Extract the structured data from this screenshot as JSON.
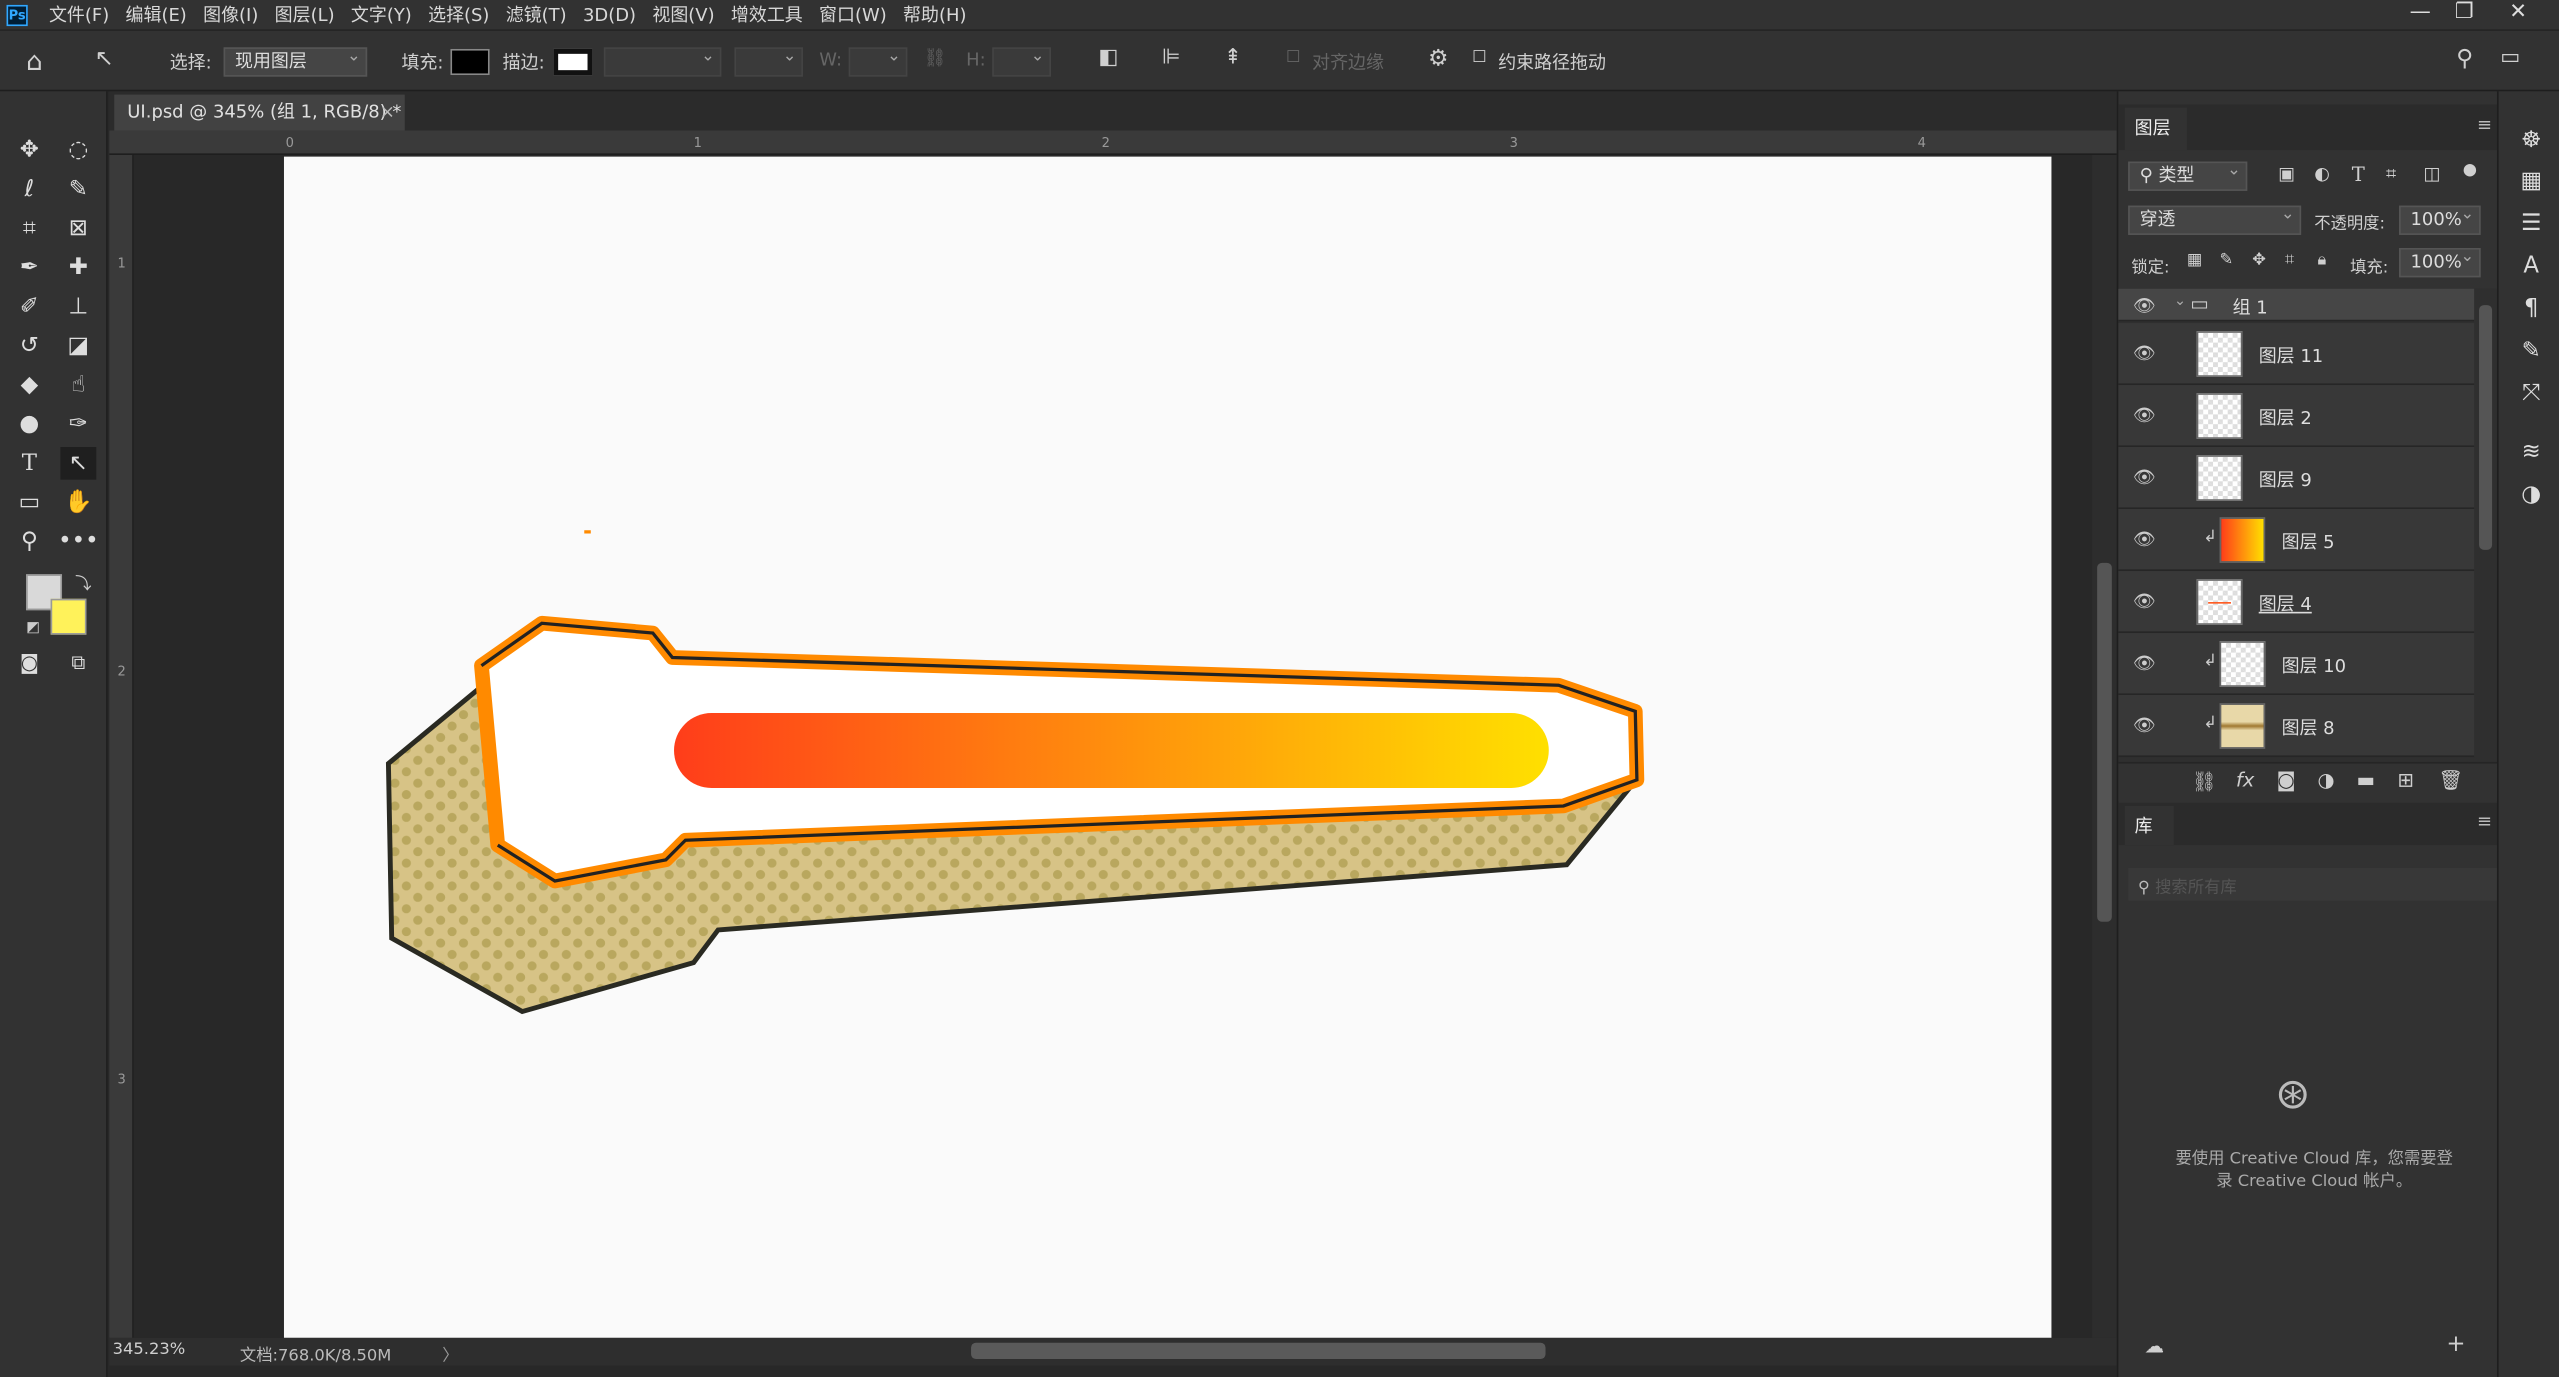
{
  "app": {
    "logo": "Ps",
    "menus": [
      "文件(F)",
      "编辑(E)",
      "图像(I)",
      "图层(L)",
      "文字(Y)",
      "选择(S)",
      "滤镜(T)",
      "3D(D)",
      "视图(V)",
      "增效工具",
      "窗口(W)",
      "帮助(H)"
    ],
    "window_controls": [
      "—",
      "❐",
      "✕"
    ]
  },
  "options": {
    "select_label": "选择:",
    "select_value": "现用图层",
    "fill_label": "填充:",
    "fill_color": "#000000",
    "stroke_label": "描边:",
    "w_label": "W:",
    "h_label": "H:",
    "align_edges_label": "对齐边缘",
    "constrain_label": "约束路径拖动"
  },
  "document": {
    "tab_title": "UI.psd @ 345% (组 1, RGB/8) *",
    "close": "×",
    "ruler_h": [
      "0",
      "1",
      "2",
      "3",
      "4"
    ],
    "ruler_v": [
      "1",
      "2",
      "3"
    ]
  },
  "status": {
    "zoom": "345.23%",
    "doc_info": "文档:768.0K/8.50M",
    "arrow": "〉"
  },
  "colors": {
    "foreground": "#d9d9d9",
    "background": "#fff25a",
    "bar_start": "#ff3d1a",
    "bar_end": "#ffe000",
    "frame_orange": "#ff8a00",
    "base_tan": "#d7c386"
  },
  "layers_panel": {
    "title": "图层",
    "filter_label": "类型",
    "blend_mode": "穿透",
    "opacity_label": "不透明度:",
    "opacity_value": "100%",
    "lock_label": "锁定:",
    "fill_label": "填充:",
    "fill_value": "100%",
    "group_name": "组 1",
    "layers": [
      {
        "name": "图层 11"
      },
      {
        "name": "图层 2"
      },
      {
        "name": "图层 9"
      },
      {
        "name": "图层 5"
      },
      {
        "name": "图层 4"
      },
      {
        "name": "图层 10"
      },
      {
        "name": "图层 8"
      }
    ]
  },
  "library_panel": {
    "title": "库",
    "search_placeholder": "搜索所有库",
    "message_line1": "要使用 Creative Cloud 库，您需要登",
    "message_line2": "录 Creative Cloud 帐户。"
  }
}
